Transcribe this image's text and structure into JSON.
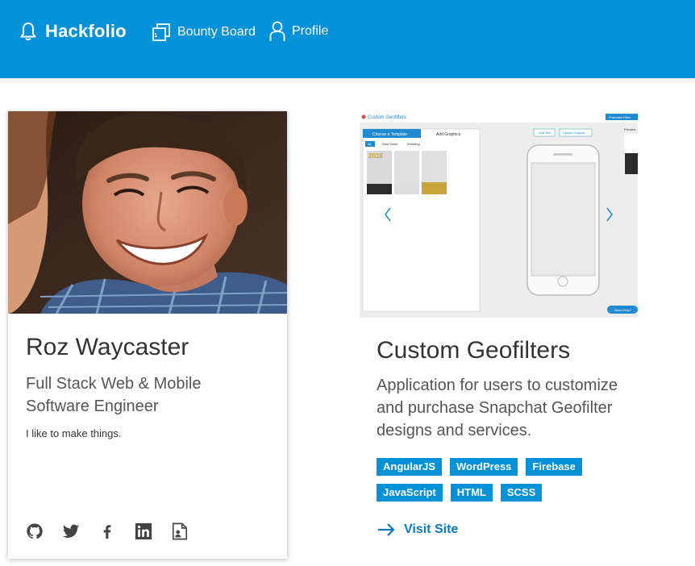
{
  "header": {
    "brand": "Hackfolio",
    "nav": [
      {
        "label": "Bounty Board",
        "icon": "copy-icon"
      },
      {
        "label": "Profile",
        "icon": "person-icon"
      }
    ],
    "bg_color": "#0391d8"
  },
  "profile": {
    "name": "Roz Waycaster",
    "title": "Full Stack Web & Mobile Software Engineer",
    "tagline": "I like to make things.",
    "socials": [
      "github-icon",
      "twitter-icon",
      "facebook-icon",
      "linkedin-icon",
      "resume-icon"
    ]
  },
  "project": {
    "title": "Custom Geofilters",
    "description": "Application for users to customize and purchase Snapchat Geofilter designs and services.",
    "tags": [
      "AngularJS",
      "WordPress",
      "Firebase",
      "JavaScript",
      "HTML",
      "SCSS"
    ],
    "link_label": "Visit Site",
    "screenshot": {
      "app_title": "Custom Geofilters",
      "purchase_button": "Purchase Filter",
      "tabs": [
        "Choose a Template",
        "Add Graphics"
      ],
      "filters": [
        "All",
        "New Years",
        "Wedding"
      ],
      "toolbar": [
        "Add Text",
        "Upload Graphic"
      ],
      "preview_label": "Preview",
      "help_button": "Need Help?",
      "thumb_labels": [
        "2018",
        "Happy New Year",
        "Williams",
        "Celebrate"
      ]
    }
  }
}
